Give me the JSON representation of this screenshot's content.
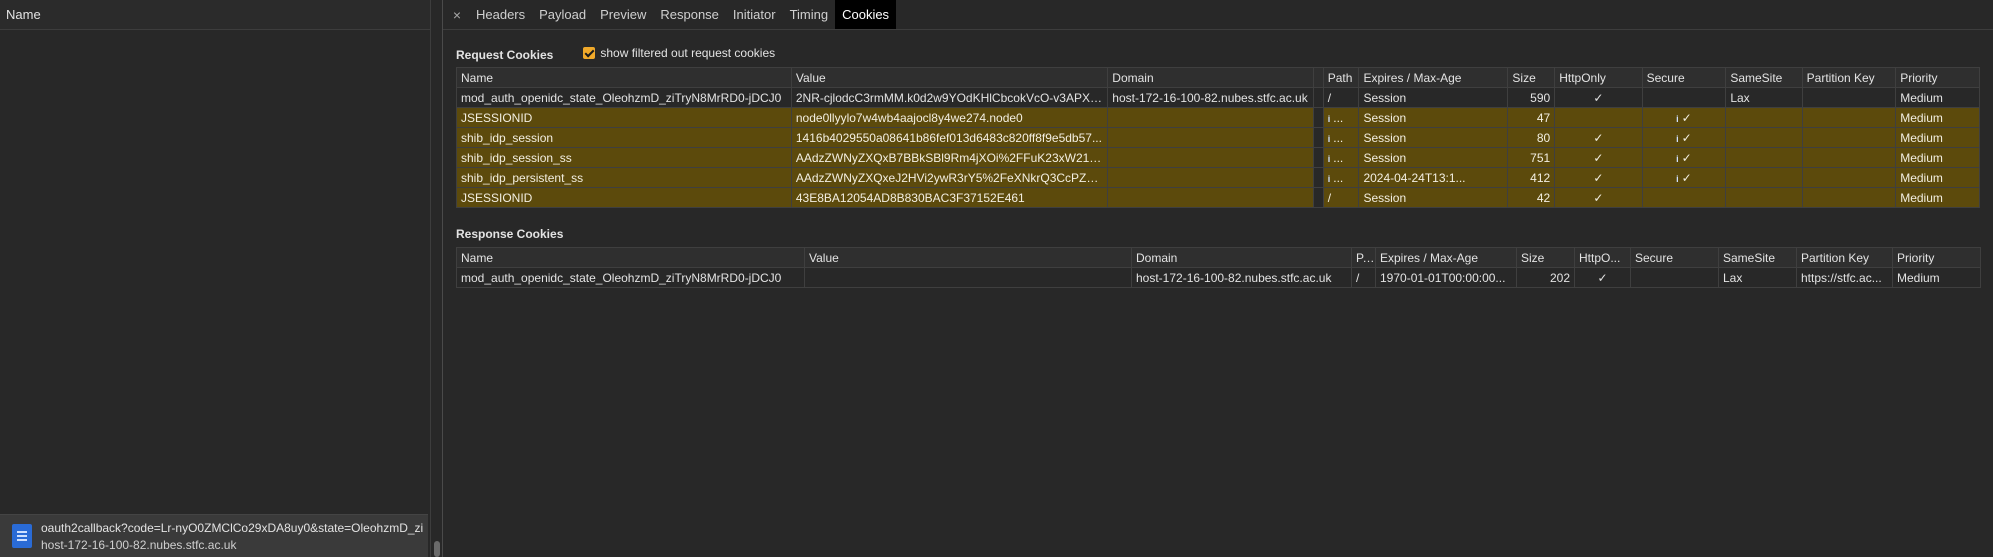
{
  "left": {
    "header": "Name",
    "request": {
      "name": "oauth2callback?code=Lr-nyO0ZMClCo29xDA8uy0&state=OleohzmD_zi",
      "host": "host-172-16-100-82.nubes.stfc.ac.uk"
    }
  },
  "tabs": {
    "close": "×",
    "items": [
      "Headers",
      "Payload",
      "Preview",
      "Response",
      "Initiator",
      "Timing",
      "Cookies"
    ],
    "active": "Cookies"
  },
  "request_cookies": {
    "title": "Request Cookies",
    "filter_label": "show filtered out request cookies",
    "filter_checked": true,
    "columns": [
      "Name",
      "Value",
      "Domain",
      "Path",
      "Expires / Max-Age",
      "Size",
      "HttpOnly",
      "Secure",
      "SameSite",
      "Partition Key",
      "Priority"
    ],
    "rows": [
      {
        "name": "mod_auth_openidc_state_OleohzmD_ziTryN8MrRD0-jDCJ0",
        "value": "2NR-cjlodcC3rmMM.k0d2w9YOdKHlCbcokVcO-v3APXy...",
        "domain": "host-172-16-100-82.nubes.stfc.ac.uk",
        "path": "/",
        "expires": "Session",
        "size": "590",
        "httponly": "✓",
        "secure": "",
        "samesite": "Lax",
        "partition": "",
        "priority": "Medium",
        "blocked": false
      },
      {
        "name": "JSESSIONID",
        "value": "node0llyylo7w4wb4aajocl8y4we274.node0",
        "domain": "",
        "path": "...",
        "expires": "Session",
        "size": "47",
        "httponly": "",
        "secure": "✓",
        "samesite": "",
        "partition": "",
        "priority": "Medium",
        "blocked": true
      },
      {
        "name": "shib_idp_session",
        "value": "1416b4029550a08641b86fef013d6483c820ff8f9e5db57...",
        "domain": "",
        "path": "...",
        "expires": "Session",
        "size": "80",
        "httponly": "✓",
        "secure": "✓",
        "samesite": "",
        "partition": "",
        "priority": "Medium",
        "blocked": true
      },
      {
        "name": "shib_idp_session_ss",
        "value": "AAdzZWNyZXQxB7BBkSBl9Rm4jXOi%2FFuK23xW21z...",
        "domain": "",
        "path": "...",
        "expires": "Session",
        "size": "751",
        "httponly": "✓",
        "secure": "✓",
        "samesite": "",
        "partition": "",
        "priority": "Medium",
        "blocked": true
      },
      {
        "name": "shib_idp_persistent_ss",
        "value": "AAdzZWNyZXQxeJ2HVi2ywR3rY5%2FeXNkrQ3CcPZsS...",
        "domain": "",
        "path": "...",
        "expires": "2024-04-24T13:1...",
        "size": "412",
        "httponly": "✓",
        "secure": "✓",
        "samesite": "",
        "partition": "",
        "priority": "Medium",
        "blocked": true
      },
      {
        "name": "JSESSIONID",
        "value": "43E8BA12054AD8B830BAC3F37152E461",
        "domain": "",
        "path": "/",
        "expires": "Session",
        "size": "42",
        "httponly": "✓",
        "secure": "",
        "samesite": "",
        "partition": "",
        "priority": "Medium",
        "blocked": true
      }
    ]
  },
  "response_cookies": {
    "title": "Response Cookies",
    "columns": [
      "Name",
      "Value",
      "Domain",
      "P...",
      "Expires / Max-Age",
      "Size",
      "HttpO...",
      "Secure",
      "SameSite",
      "Partition Key",
      "Priority"
    ],
    "rows": [
      {
        "name": "mod_auth_openidc_state_OleohzmD_ziTryN8MrRD0-jDCJ0",
        "value": "",
        "domain": "host-172-16-100-82.nubes.stfc.ac.uk",
        "path": "/",
        "expires": "1970-01-01T00:00:00...",
        "size": "202",
        "httponly": "✓",
        "secure": "",
        "samesite": "Lax",
        "partition": "https://stfc.ac...",
        "priority": "Medium"
      }
    ]
  }
}
